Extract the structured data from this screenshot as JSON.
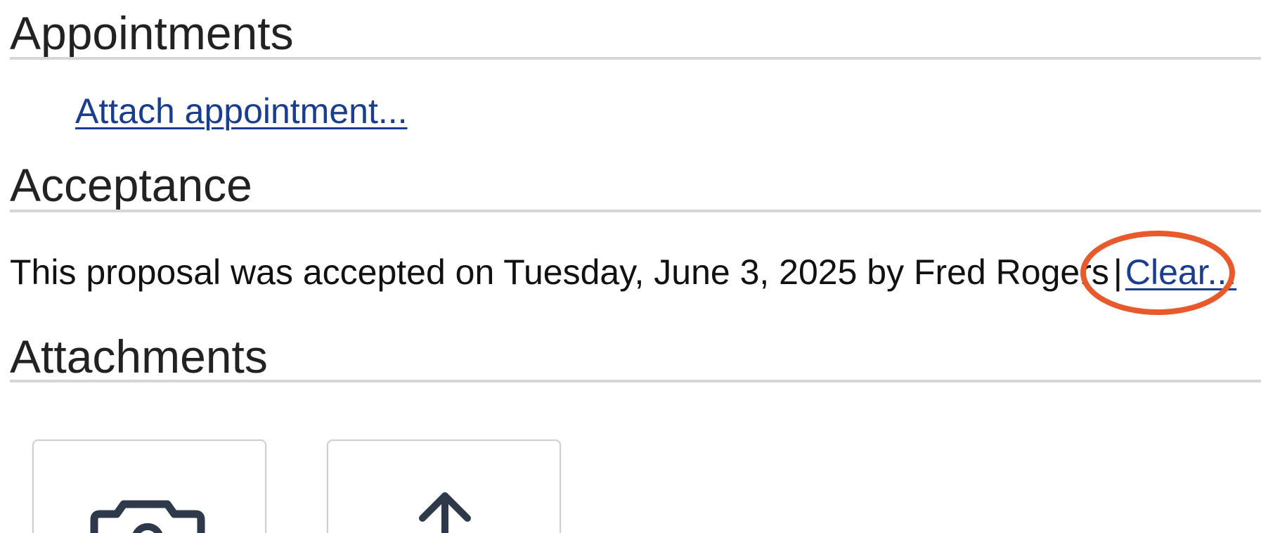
{
  "sections": {
    "appointments": {
      "title": "Appointments",
      "attach_link": "Attach appointment..."
    },
    "acceptance": {
      "title": "Acceptance",
      "status_text": "This proposal was accepted on Tuesday, June 3, 2025 by Fred Rogers",
      "separator": "|",
      "clear_link": "Clear..."
    },
    "attachments": {
      "title": "Attachments",
      "tiles": [
        {
          "icon": "camera-icon"
        },
        {
          "icon": "upload-icon"
        }
      ]
    }
  },
  "colors": {
    "link": "#1a3d8f",
    "highlight": "#e85a2c",
    "rule": "#d6d6d6",
    "icon": "#2e3a4b"
  }
}
